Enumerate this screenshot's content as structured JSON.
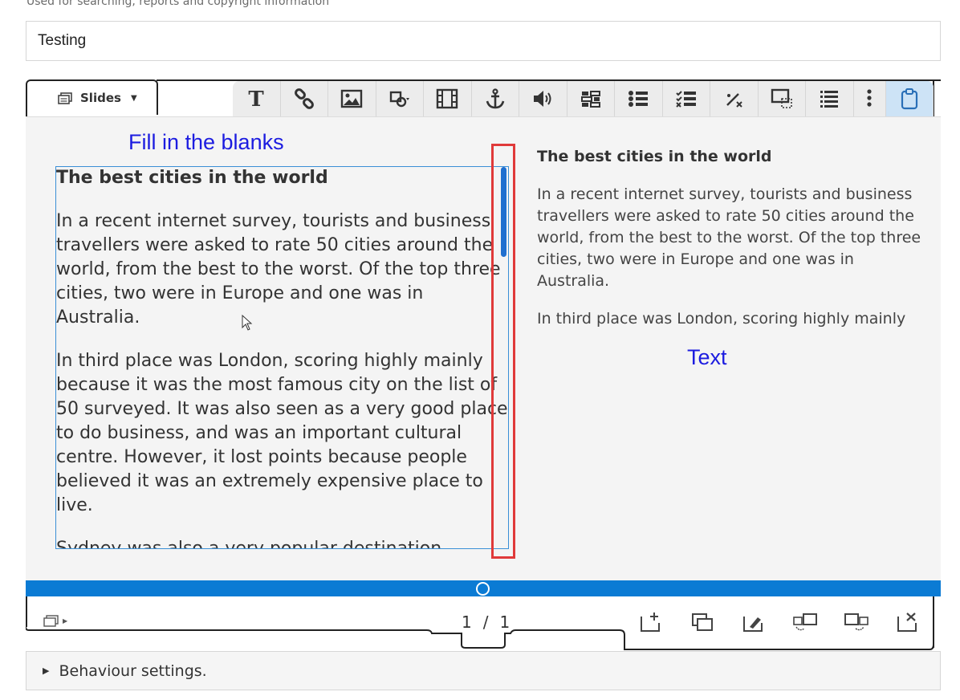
{
  "form": {
    "helper_text": "Used for searching, reports and copyright information",
    "title_value": "Testing"
  },
  "editor": {
    "tab_label": "Slides",
    "toolbar_icons": [
      "text-icon",
      "link-icon",
      "image-icon",
      "shapes-icon",
      "video-icon",
      "anchor-icon",
      "audio-icon",
      "fill-in-blanks-icon",
      "single-choice-icon",
      "multi-choice-icon",
      "mark-words-icon",
      "drag-and-drop-icon",
      "summary-icon",
      "more-icon",
      "paste-icon"
    ],
    "annotations": {
      "fill_label": "Fill in the blanks",
      "text_label": "Text"
    },
    "fill_blanks": {
      "title": "The best cities in the world",
      "paragraphs": [
        "In a recent internet survey, tourists and business travellers were asked to rate 50 cities around the world, from the best to the worst. Of the top three cities, two were in Europe and one was in Australia.",
        "In third place was London, scoring highly mainly because it was the most famous city on the list of 50 surveyed. It was also seen as a very good place to do business, and was an important cultural centre. However, it lost points because people believed it was an extremely expensive place to live.",
        "Sydney was also a very popular destination, achieving second place on the list because people"
      ]
    },
    "text_preview": {
      "title": "The best cities in the world",
      "paragraphs": [
        "In a recent internet survey, tourists and business travellers were asked to rate 50 cities around the world, from the best to the worst. Of the top three cities, two were in Europe and one was in Australia.",
        "In third place was London, scoring highly mainly"
      ]
    },
    "pager": {
      "current": "1",
      "separator": "/",
      "total": "1"
    },
    "bottom_tools": [
      "add-slide-icon",
      "clone-slide-icon",
      "slide-background-icon",
      "move-slide-left-icon",
      "move-slide-right-icon",
      "delete-slide-icon"
    ]
  },
  "behaviour": {
    "label": "Behaviour settings."
  },
  "colors": {
    "accent": "#0b7bd4",
    "annotation_blue": "#1c1ce0",
    "highlight_red": "#e03a3a",
    "active_tool_bg": "#cde3f6"
  }
}
